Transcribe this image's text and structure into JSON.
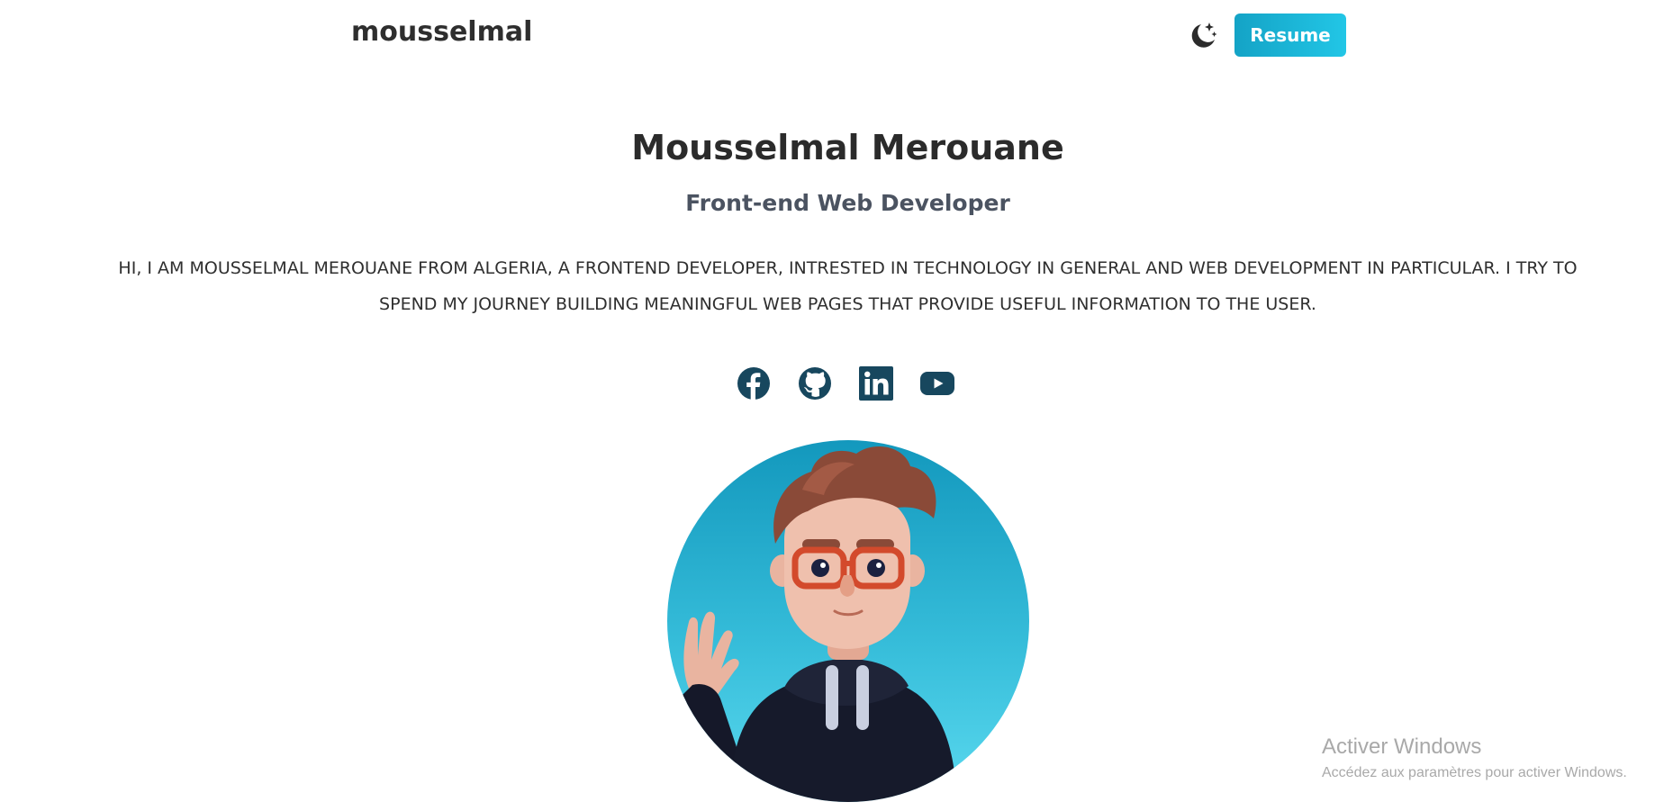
{
  "header": {
    "logo_text": "mousselmal",
    "resume_label": "Resume"
  },
  "hero": {
    "name": "Mousselmal Merouane",
    "role": "Front-end Web Developer",
    "description": "HI, I AM MOUSSELMAL MEROUANE FROM ALGERIA, A FRONTEND DEVELOPER, INTRESTED IN TECHNOLOGY IN GENERAL AND WEB DEVELOPMENT IN PARTICULAR. I TRY TO SPEND MY JOURNEY BUILDING MEANINGFUL WEB PAGES THAT PROVIDE USEFUL INFORMATION TO THE USER."
  },
  "socials": [
    {
      "icon": "facebook-icon"
    },
    {
      "icon": "github-icon"
    },
    {
      "icon": "linkedin-icon"
    },
    {
      "icon": "youtube-icon"
    }
  ],
  "watermark": {
    "title": "Activer Windows",
    "subtitle": "Accédez aux paramètres pour activer Windows."
  },
  "colors": {
    "accent": "#1aafd3",
    "icon": "#17475e",
    "text": "#2d2d2d"
  }
}
